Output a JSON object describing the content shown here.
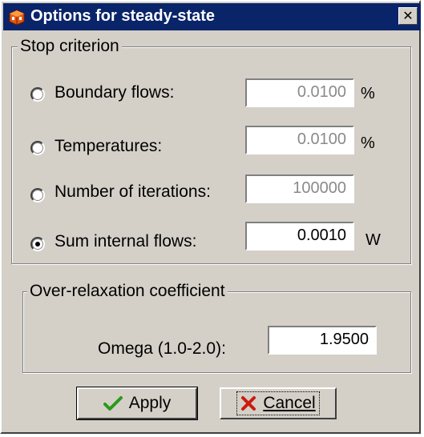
{
  "window": {
    "title": "Options for steady-state",
    "title_icon": "app-cube-icon",
    "close_glyph": "✕"
  },
  "stop_criterion": {
    "legend": "Stop criterion",
    "options": [
      {
        "label": "Boundary flows:",
        "value": "0.0100",
        "unit": "%",
        "selected": false,
        "enabled": false
      },
      {
        "label": "Temperatures:",
        "value": "0.0100",
        "unit": "%",
        "selected": false,
        "enabled": false
      },
      {
        "label": "Number of iterations:",
        "value": "100000",
        "unit": "",
        "selected": false,
        "enabled": false
      },
      {
        "label": "Sum internal flows:",
        "value": "0.0010",
        "unit": "W",
        "selected": true,
        "enabled": true
      }
    ]
  },
  "relaxation": {
    "legend": "Over-relaxation coefficient",
    "label": "Omega (1.0-2.0):",
    "value": "1.9500"
  },
  "buttons": {
    "apply": {
      "label": "Apply",
      "icon": "checkmark-icon",
      "color": "#2a9a1c"
    },
    "cancel": {
      "label": "Cancel",
      "icon": "x-icon",
      "color": "#cc1a10"
    }
  },
  "colors": {
    "face": "#d4d0c8",
    "titlebar": "#0a246a"
  }
}
